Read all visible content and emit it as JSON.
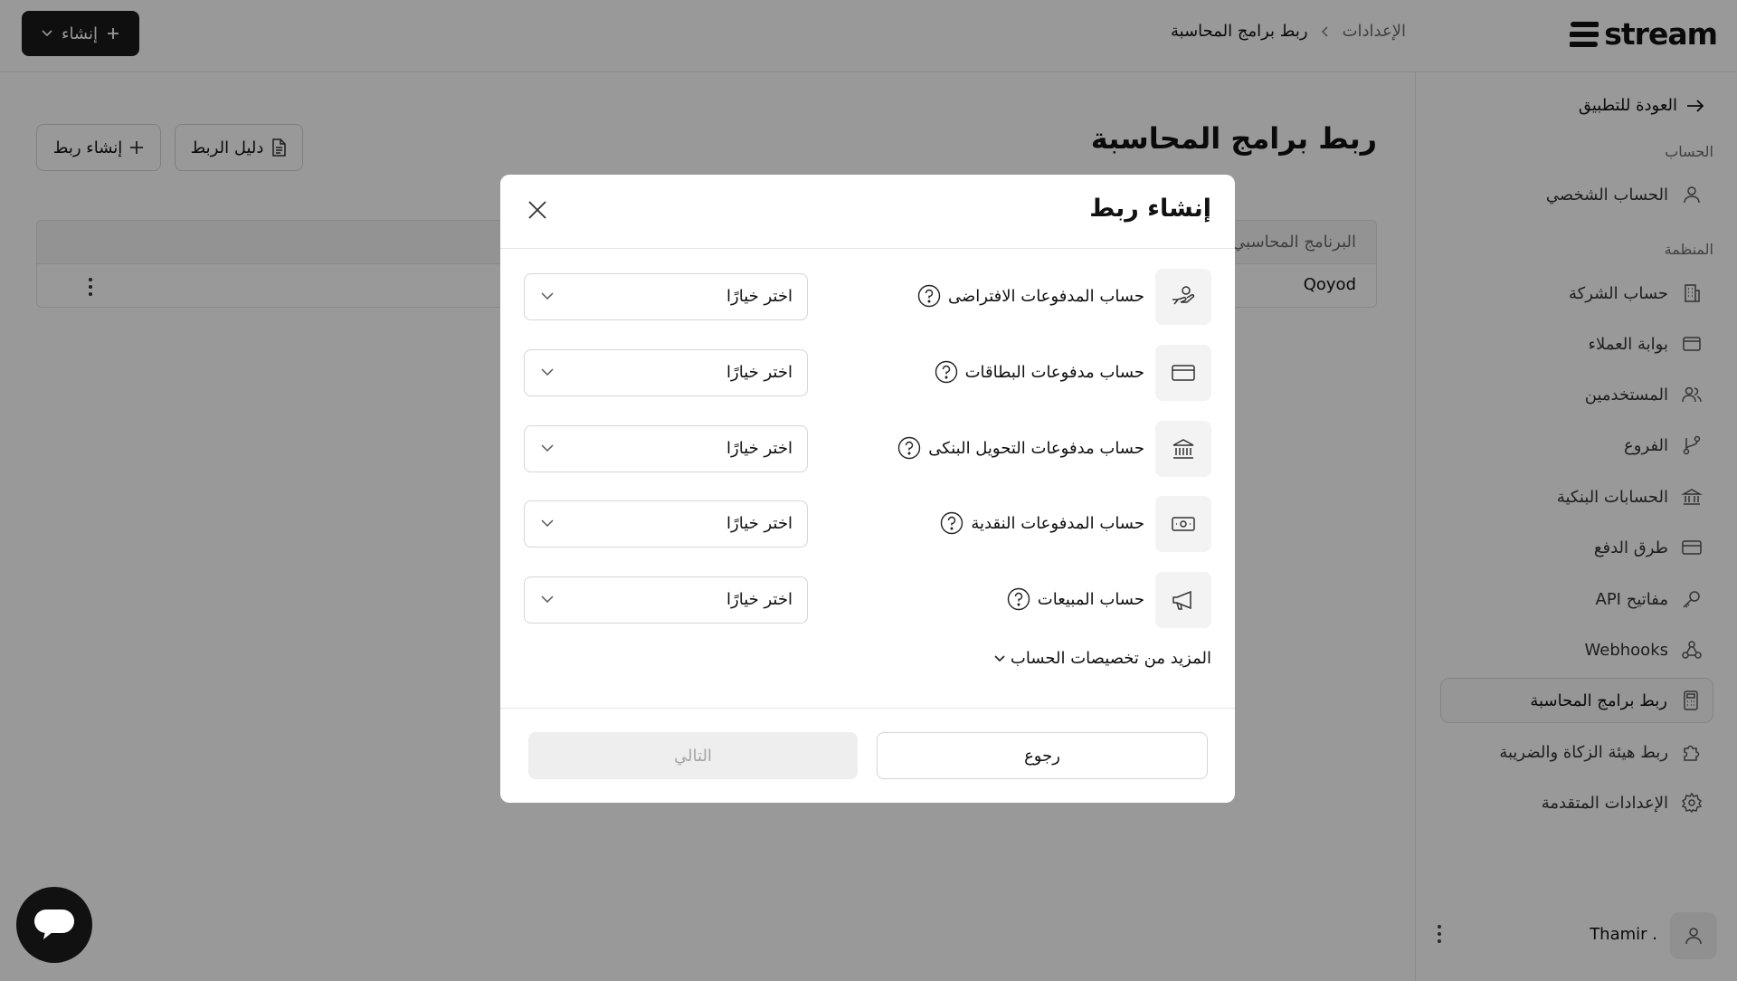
{
  "app": {
    "brand": "stream",
    "create_button_label": "إنشاء"
  },
  "breadcrumb": {
    "root": "الإعدادات",
    "current": "ربط برامج المحاسبة"
  },
  "sidebar": {
    "back_label": "العودة للتطبيق",
    "account_section": "الحساب",
    "org_section": "المنظمة",
    "items": [
      {
        "label": "الحساب الشخصي",
        "icon": "user-icon"
      },
      {
        "label": "حساب الشركة",
        "icon": "building-icon"
      },
      {
        "label": "بوابة العملاء",
        "icon": "window-icon"
      },
      {
        "label": "المستخدمين",
        "icon": "users-icon"
      },
      {
        "label": "الفروع",
        "icon": "git-branch-icon"
      },
      {
        "label": "الحسابات البنكية",
        "icon": "bank-icon"
      },
      {
        "label": "طرق الدفع",
        "icon": "credit-card-icon"
      },
      {
        "label": "مفاتيح API",
        "icon": "key-icon"
      },
      {
        "label": "Webhooks",
        "icon": "webhook-icon"
      },
      {
        "label": "ربط برامج المحاسبة",
        "icon": "calculator-icon",
        "active": true
      },
      {
        "label": "ربط هيئة الزكاة والضريبة",
        "icon": "puzzle-icon"
      },
      {
        "label": "الإعدادات المتقدمة",
        "icon": "gear-icon"
      }
    ],
    "user_name": "Thamir ."
  },
  "main": {
    "title": "ربط برامج المحاسبة",
    "guide_button": "دليل الربط",
    "create_link_button": "إنشاء ربط",
    "table": {
      "header": "البرنامج المحاسبي",
      "rows": [
        {
          "program": "Qoyod"
        }
      ]
    }
  },
  "modal": {
    "title": "إنشاء ربط",
    "fields": [
      {
        "label": "حساب المدفوعات الافتراضى",
        "icon": "hand-coins-icon",
        "value": "اختر خيارًا"
      },
      {
        "label": "حساب مدفوعات البطاقات",
        "icon": "credit-card-icon",
        "value": "اختر خيارًا"
      },
      {
        "label": "حساب مدفوعات التحويل البنكى",
        "icon": "bank-icon",
        "value": "اختر خيارًا"
      },
      {
        "label": "حساب المدفوعات النقدية",
        "icon": "cash-icon",
        "value": "اختر خيارًا"
      },
      {
        "label": "حساب المبيعات",
        "icon": "megaphone-icon",
        "value": "اختر خيارًا"
      }
    ],
    "more_label": "المزيد من تخصيصات الحساب",
    "back_button": "رجوع",
    "next_button": "التالي"
  },
  "colors": {
    "overlay": "#000000",
    "primary_dark": "#1a1a1a",
    "disabled_bg": "#eeeeee",
    "disabled_text": "#a5a5a5"
  }
}
